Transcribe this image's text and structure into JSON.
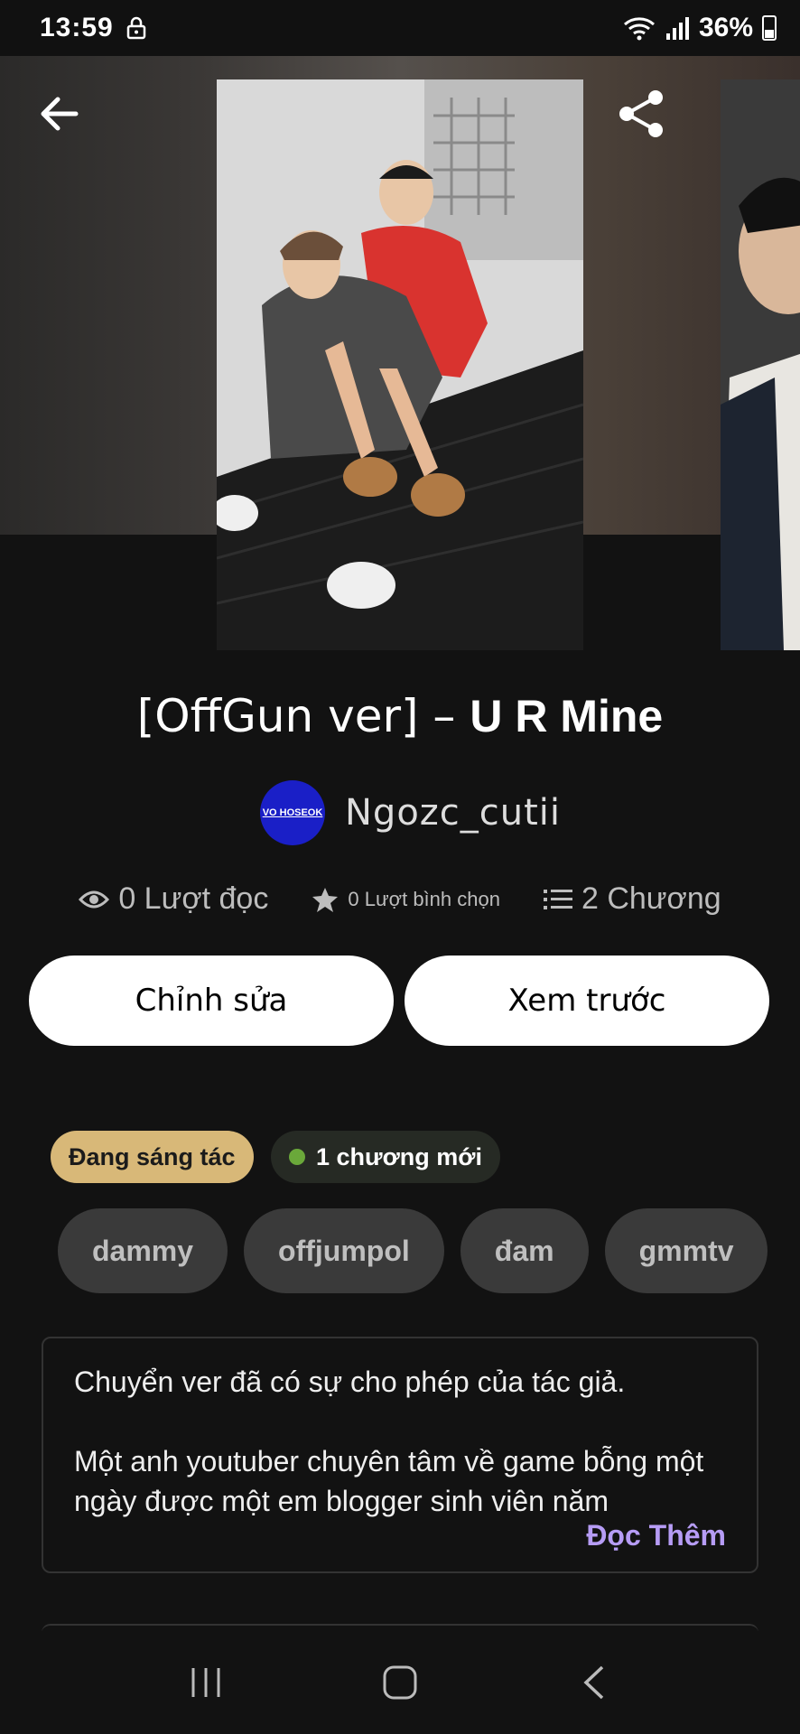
{
  "status_bar": {
    "time": "13:59",
    "battery": "36%"
  },
  "story": {
    "title_prefix": "[OffGun ver] – ",
    "title_main": "U R Mine",
    "author": {
      "name": "Ngozc_cutii",
      "avatar_text": "VO HOSEOK"
    }
  },
  "stats": {
    "reads": "0 Lượt đọc",
    "votes": "0 Lượt bình chọn",
    "chapters": "2 Chương"
  },
  "actions": {
    "edit": "Chỉnh sửa",
    "preview": "Xem trước"
  },
  "badges": {
    "status": "Đang sáng tác",
    "new_chapter": "1 chương mới"
  },
  "tags": [
    "dammy",
    "offjumpol",
    "đam",
    "gmmtv"
  ],
  "description": {
    "line1": "Chuyển ver đã có sự cho phép của tác giả.",
    "line2": "Một anh youtuber chuyên tâm về game bỗng một ngày được một em blogger sinh viên năm",
    "read_more": "Đọc Thêm"
  }
}
